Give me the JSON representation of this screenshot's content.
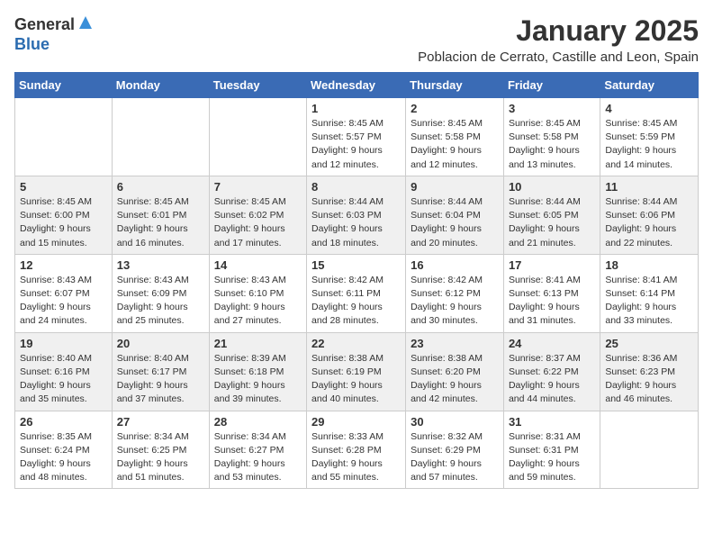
{
  "logo": {
    "general": "General",
    "blue": "Blue"
  },
  "title": "January 2025",
  "subtitle": "Poblacion de Cerrato, Castille and Leon, Spain",
  "weekdays": [
    "Sunday",
    "Monday",
    "Tuesday",
    "Wednesday",
    "Thursday",
    "Friday",
    "Saturday"
  ],
  "weeks": [
    [
      {
        "day": "",
        "detail": ""
      },
      {
        "day": "",
        "detail": ""
      },
      {
        "day": "",
        "detail": ""
      },
      {
        "day": "1",
        "detail": "Sunrise: 8:45 AM\nSunset: 5:57 PM\nDaylight: 9 hours and 12 minutes."
      },
      {
        "day": "2",
        "detail": "Sunrise: 8:45 AM\nSunset: 5:58 PM\nDaylight: 9 hours and 12 minutes."
      },
      {
        "day": "3",
        "detail": "Sunrise: 8:45 AM\nSunset: 5:58 PM\nDaylight: 9 hours and 13 minutes."
      },
      {
        "day": "4",
        "detail": "Sunrise: 8:45 AM\nSunset: 5:59 PM\nDaylight: 9 hours and 14 minutes."
      }
    ],
    [
      {
        "day": "5",
        "detail": "Sunrise: 8:45 AM\nSunset: 6:00 PM\nDaylight: 9 hours and 15 minutes."
      },
      {
        "day": "6",
        "detail": "Sunrise: 8:45 AM\nSunset: 6:01 PM\nDaylight: 9 hours and 16 minutes."
      },
      {
        "day": "7",
        "detail": "Sunrise: 8:45 AM\nSunset: 6:02 PM\nDaylight: 9 hours and 17 minutes."
      },
      {
        "day": "8",
        "detail": "Sunrise: 8:44 AM\nSunset: 6:03 PM\nDaylight: 9 hours and 18 minutes."
      },
      {
        "day": "9",
        "detail": "Sunrise: 8:44 AM\nSunset: 6:04 PM\nDaylight: 9 hours and 20 minutes."
      },
      {
        "day": "10",
        "detail": "Sunrise: 8:44 AM\nSunset: 6:05 PM\nDaylight: 9 hours and 21 minutes."
      },
      {
        "day": "11",
        "detail": "Sunrise: 8:44 AM\nSunset: 6:06 PM\nDaylight: 9 hours and 22 minutes."
      }
    ],
    [
      {
        "day": "12",
        "detail": "Sunrise: 8:43 AM\nSunset: 6:07 PM\nDaylight: 9 hours and 24 minutes."
      },
      {
        "day": "13",
        "detail": "Sunrise: 8:43 AM\nSunset: 6:09 PM\nDaylight: 9 hours and 25 minutes."
      },
      {
        "day": "14",
        "detail": "Sunrise: 8:43 AM\nSunset: 6:10 PM\nDaylight: 9 hours and 27 minutes."
      },
      {
        "day": "15",
        "detail": "Sunrise: 8:42 AM\nSunset: 6:11 PM\nDaylight: 9 hours and 28 minutes."
      },
      {
        "day": "16",
        "detail": "Sunrise: 8:42 AM\nSunset: 6:12 PM\nDaylight: 9 hours and 30 minutes."
      },
      {
        "day": "17",
        "detail": "Sunrise: 8:41 AM\nSunset: 6:13 PM\nDaylight: 9 hours and 31 minutes."
      },
      {
        "day": "18",
        "detail": "Sunrise: 8:41 AM\nSunset: 6:14 PM\nDaylight: 9 hours and 33 minutes."
      }
    ],
    [
      {
        "day": "19",
        "detail": "Sunrise: 8:40 AM\nSunset: 6:16 PM\nDaylight: 9 hours and 35 minutes."
      },
      {
        "day": "20",
        "detail": "Sunrise: 8:40 AM\nSunset: 6:17 PM\nDaylight: 9 hours and 37 minutes."
      },
      {
        "day": "21",
        "detail": "Sunrise: 8:39 AM\nSunset: 6:18 PM\nDaylight: 9 hours and 39 minutes."
      },
      {
        "day": "22",
        "detail": "Sunrise: 8:38 AM\nSunset: 6:19 PM\nDaylight: 9 hours and 40 minutes."
      },
      {
        "day": "23",
        "detail": "Sunrise: 8:38 AM\nSunset: 6:20 PM\nDaylight: 9 hours and 42 minutes."
      },
      {
        "day": "24",
        "detail": "Sunrise: 8:37 AM\nSunset: 6:22 PM\nDaylight: 9 hours and 44 minutes."
      },
      {
        "day": "25",
        "detail": "Sunrise: 8:36 AM\nSunset: 6:23 PM\nDaylight: 9 hours and 46 minutes."
      }
    ],
    [
      {
        "day": "26",
        "detail": "Sunrise: 8:35 AM\nSunset: 6:24 PM\nDaylight: 9 hours and 48 minutes."
      },
      {
        "day": "27",
        "detail": "Sunrise: 8:34 AM\nSunset: 6:25 PM\nDaylight: 9 hours and 51 minutes."
      },
      {
        "day": "28",
        "detail": "Sunrise: 8:34 AM\nSunset: 6:27 PM\nDaylight: 9 hours and 53 minutes."
      },
      {
        "day": "29",
        "detail": "Sunrise: 8:33 AM\nSunset: 6:28 PM\nDaylight: 9 hours and 55 minutes."
      },
      {
        "day": "30",
        "detail": "Sunrise: 8:32 AM\nSunset: 6:29 PM\nDaylight: 9 hours and 57 minutes."
      },
      {
        "day": "31",
        "detail": "Sunrise: 8:31 AM\nSunset: 6:31 PM\nDaylight: 9 hours and 59 minutes."
      },
      {
        "day": "",
        "detail": ""
      }
    ]
  ]
}
